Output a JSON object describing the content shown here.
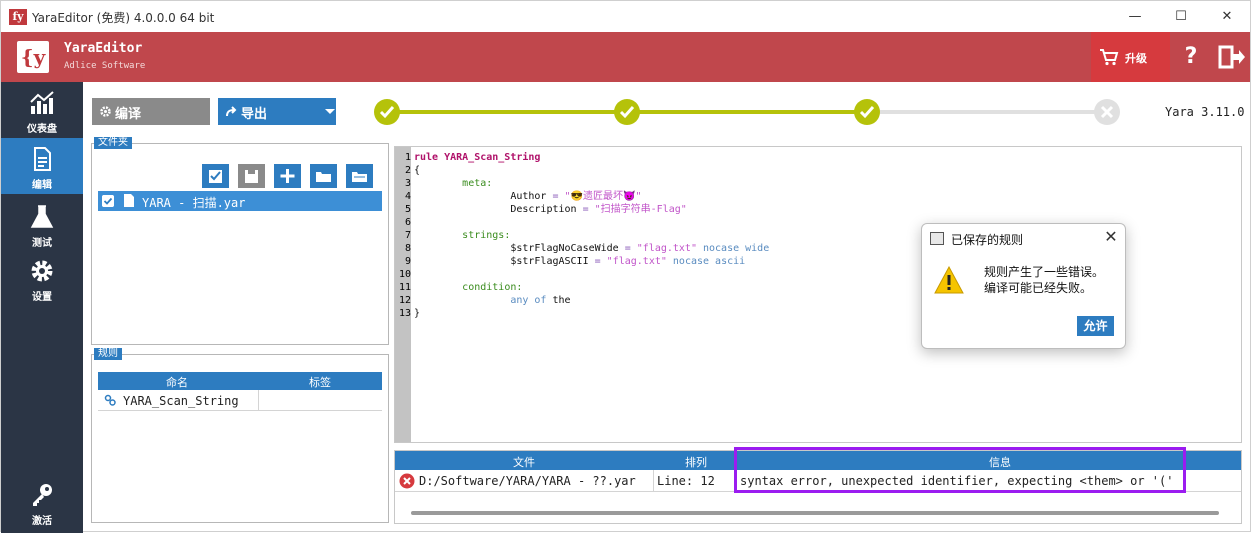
{
  "window": {
    "title": "YaraEditor (免费) 4.0.0.0 64 bit",
    "logo_text": "fy",
    "minimize": "—",
    "maximize": "☐",
    "close": "✕"
  },
  "header": {
    "brand_logo": "{y",
    "brand_name": "YaraEditor",
    "brand_sub": "Adlice Software",
    "upgrade_label": "升级",
    "help_label": "?"
  },
  "sidebar": {
    "items": [
      {
        "label": "仪表盘",
        "icon": "chart-icon"
      },
      {
        "label": "编辑",
        "icon": "document-icon",
        "active": true
      },
      {
        "label": "测试",
        "icon": "flask-icon"
      },
      {
        "label": "设置",
        "icon": "gear-icon"
      },
      {
        "label": "激活",
        "icon": "key-icon"
      }
    ]
  },
  "toolbar": {
    "compile_label": "编译",
    "export_label": "导出"
  },
  "stepper": {
    "steps": [
      "done",
      "done",
      "done",
      "inactive"
    ],
    "colors": {
      "done": "#b5c20a",
      "inactive": "#e0e0e0"
    }
  },
  "version": "Yara 3.11.0",
  "files_panel": {
    "title": "文件夹",
    "files": [
      {
        "name": "YARA - 扫描.yar",
        "checked": true
      }
    ]
  },
  "rules_panel": {
    "title": "规则",
    "columns": [
      "命名",
      "标签"
    ],
    "rows": [
      {
        "name": "YARA_Scan_String",
        "tags": ""
      }
    ]
  },
  "editor": {
    "lines": [
      {
        "n": "1",
        "indent": "",
        "parts": [
          [
            "kw",
            "rule YARA_Scan_String"
          ]
        ]
      },
      {
        "n": "2",
        "indent": "",
        "parts": [
          [
            "ky",
            "{"
          ]
        ]
      },
      {
        "n": "3",
        "indent": "\t",
        "parts": [
          [
            "cm",
            "meta:"
          ]
        ]
      },
      {
        "n": "4",
        "indent": "\t\t",
        "parts": [
          [
            "ky",
            "Author "
          ],
          [
            "op",
            "= "
          ],
          [
            "st",
            "\"😎遗匠最坏😈\""
          ]
        ]
      },
      {
        "n": "5",
        "indent": "\t\t",
        "parts": [
          [
            "ky",
            "Description "
          ],
          [
            "op",
            "= "
          ],
          [
            "st",
            "\"扫描字符串-Flag\""
          ]
        ]
      },
      {
        "n": "6",
        "indent": "",
        "parts": []
      },
      {
        "n": "7",
        "indent": "\t",
        "parts": [
          [
            "cm",
            "strings:"
          ]
        ]
      },
      {
        "n": "8",
        "indent": "\t\t",
        "parts": [
          [
            "ky",
            "$strFlagNoCaseWide "
          ],
          [
            "op",
            "= "
          ],
          [
            "st",
            "\"flag.txt\" "
          ],
          [
            "mod",
            "nocase wide"
          ]
        ]
      },
      {
        "n": "9",
        "indent": "\t\t",
        "parts": [
          [
            "ky",
            "$strFlagASCII "
          ],
          [
            "op",
            "= "
          ],
          [
            "st",
            "\"flag.txt\" "
          ],
          [
            "mod",
            "nocase ascii"
          ]
        ]
      },
      {
        "n": "10",
        "indent": "",
        "parts": []
      },
      {
        "n": "11",
        "indent": "\t",
        "parts": [
          [
            "cm",
            "condition:"
          ]
        ]
      },
      {
        "n": "12",
        "indent": "\t\t",
        "parts": [
          [
            "mod",
            "any of "
          ],
          [
            "ky",
            "the"
          ]
        ]
      },
      {
        "n": "13",
        "indent": "",
        "parts": [
          [
            "ky",
            "}"
          ]
        ]
      }
    ]
  },
  "dialog": {
    "title": "已保存的规则",
    "message_line1": "规则产生了一些错误。",
    "message_line2": "编译可能已经失败。",
    "ok_label": "允许",
    "close": "✕"
  },
  "errors": {
    "columns": [
      "文件",
      "排列",
      "信息"
    ],
    "rows": [
      {
        "file": "D:/Software/YARA/YARA - ??.yar",
        "position": "Line: 12",
        "message": "syntax error, unexpected identifier, expecting <them> or '('"
      }
    ]
  },
  "colors": {
    "header": "#c0474c",
    "accent": "#2d7cc0",
    "sidebar": "#2b3545",
    "highlight": "#9b1cf0"
  }
}
